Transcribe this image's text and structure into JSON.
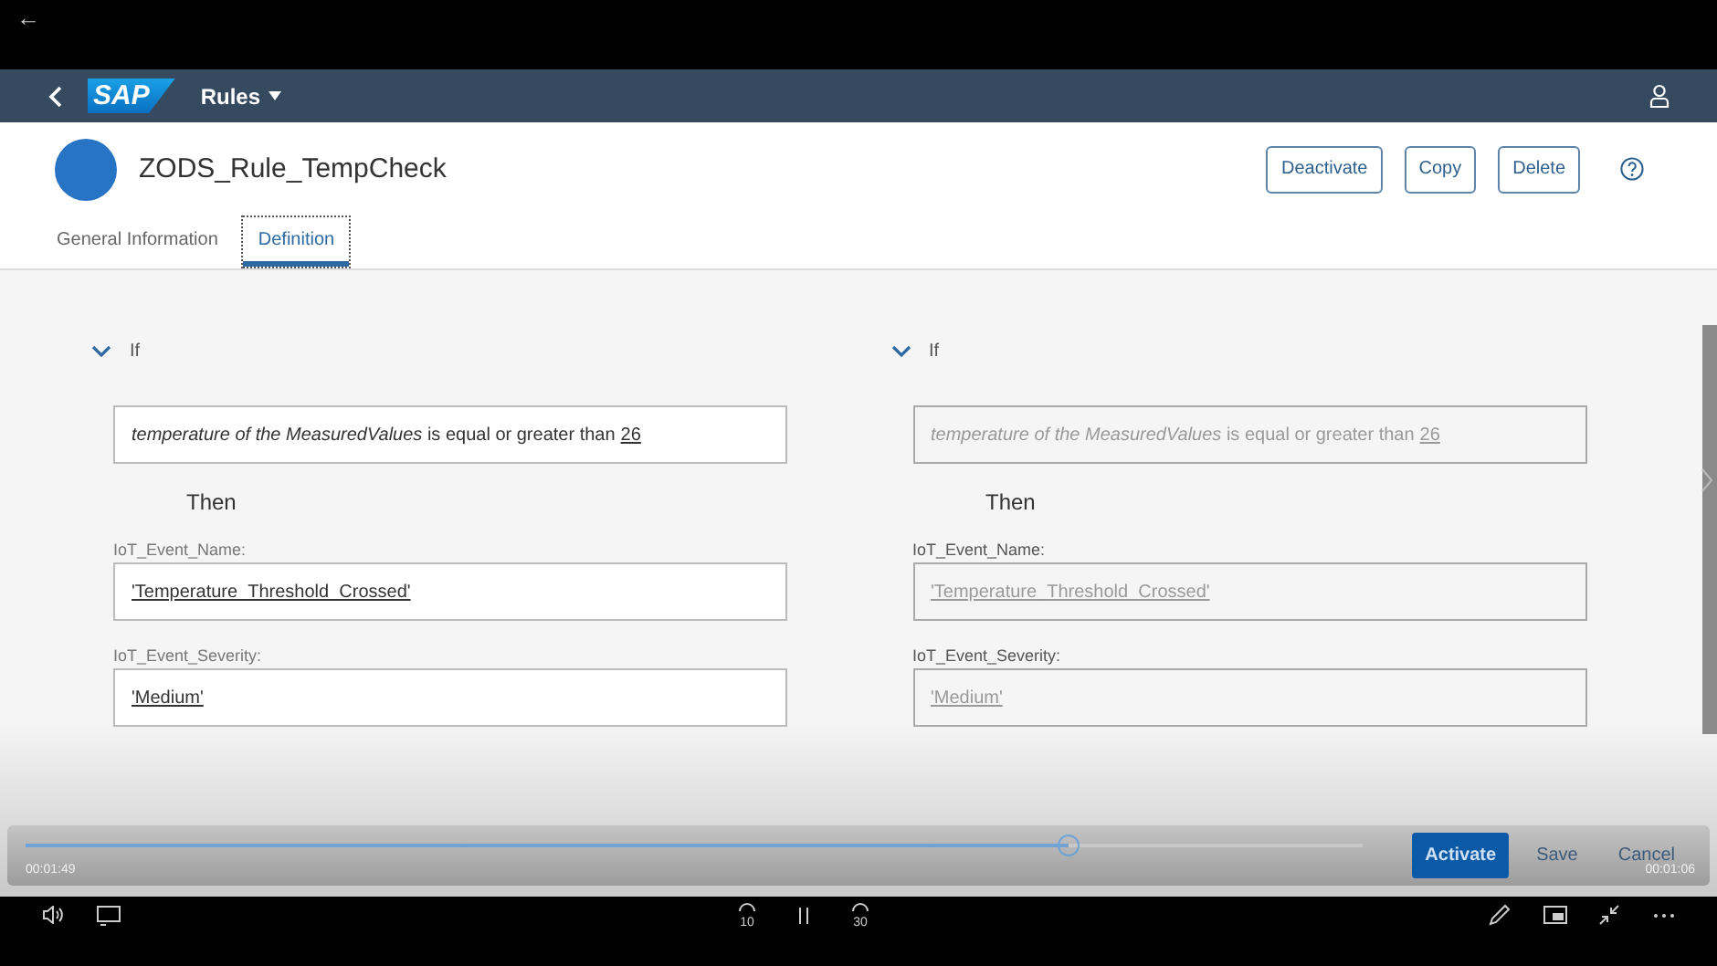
{
  "player": {
    "back": "←",
    "elapsed": "00:01:49",
    "remaining": "00:01:06",
    "progress": {
      "level": 0.78
    }
  },
  "shell": {
    "logo": "SAP",
    "menu": "Rules"
  },
  "header": {
    "title": "ZODS_Rule_TempCheck",
    "actions": [
      "Deactivate",
      "Copy",
      "Delete"
    ]
  },
  "tabs": [
    {
      "label": "General Information",
      "selected": false
    },
    {
      "label": "Definition",
      "selected": true
    }
  ],
  "panels": [
    {
      "disabled": false,
      "expanded": true,
      "if_label": "If",
      "condition": {
        "text": "*temperature of the MeasuredValues* is equal or greater than",
        "value": "26"
      },
      "then_label": "Then",
      "fields": [
        {
          "label": "IoT_Event_Name:",
          "value": "'Temperature_Threshold_Crossed'"
        },
        {
          "label": "IoT_Event_Severity:",
          "value": "'Medium'"
        }
      ]
    },
    {
      "disabled": true,
      "expanded": true,
      "if_label": "If",
      "condition": {
        "text": "*temperature of the MeasuredValues* is equal or greater than",
        "value": "26"
      },
      "then_label": "Then",
      "fields": [
        {
          "label": "IoT_Event_Name:",
          "value": "'Temperature_Threshold_Crossed'"
        },
        {
          "label": "IoT_Event_Severity:",
          "value": "'Medium'"
        }
      ]
    }
  ],
  "footer": [
    {
      "label": "Activate",
      "kind": "primary"
    },
    {
      "label": "Save",
      "kind": "plain"
    },
    {
      "label": "Cancel",
      "kind": "plain"
    }
  ],
  "controls": {
    "rewind": "10",
    "forward": "30"
  }
}
